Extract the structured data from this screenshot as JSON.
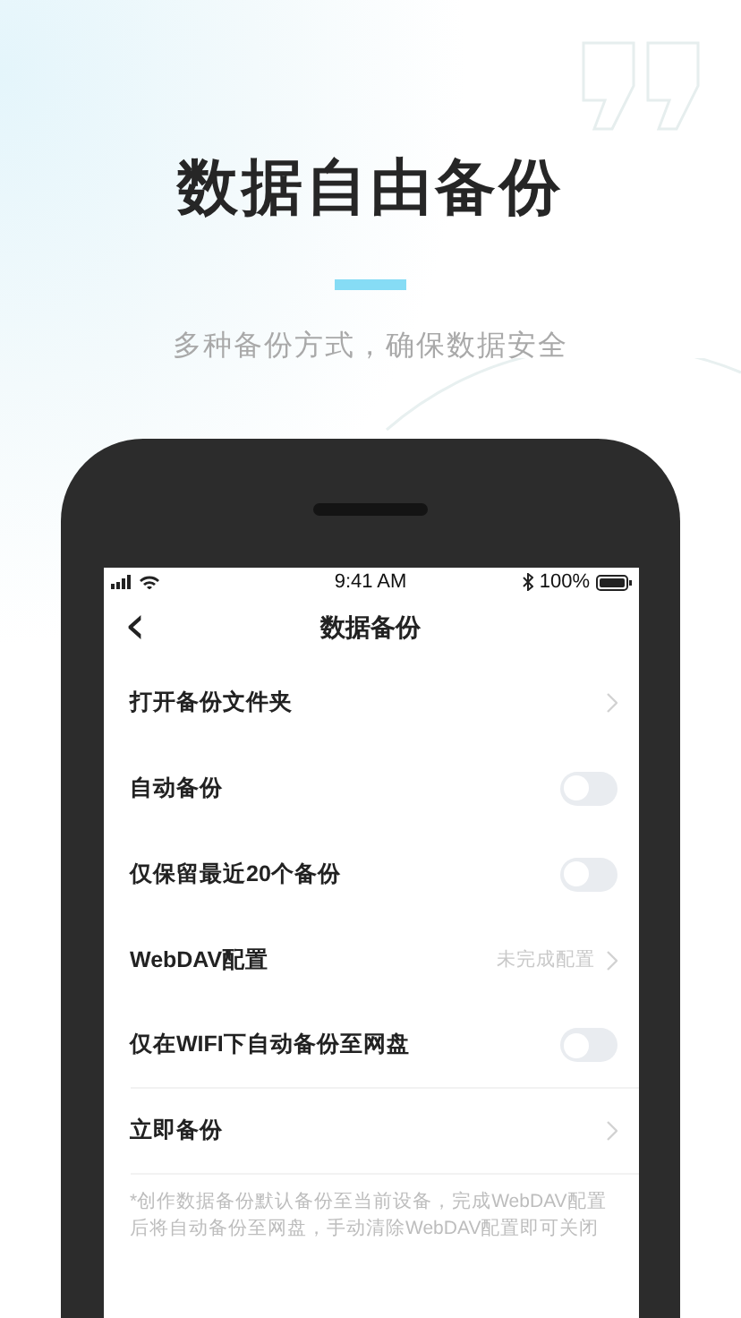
{
  "headline": "数据自由备份",
  "subtitle": "多种备份方式，确保数据安全",
  "status_bar": {
    "time": "9:41 AM",
    "battery": "100%"
  },
  "nav": {
    "back": "‹",
    "title": "数据备份"
  },
  "settings": [
    {
      "kind": "link",
      "label": "打开备份文件夹",
      "divider": false
    },
    {
      "kind": "toggle",
      "label": "自动备份",
      "on": false,
      "divider": false
    },
    {
      "kind": "toggle",
      "label": "仅保留最近20个备份",
      "on": false,
      "divider": false
    },
    {
      "kind": "link",
      "label": "WebDAV配置",
      "value": "未完成配置",
      "divider": false
    },
    {
      "kind": "toggle",
      "label": "仅在WIFI下自动备份至网盘",
      "on": false,
      "divider": true
    },
    {
      "kind": "link",
      "label": "立即备份",
      "divider": true
    }
  ],
  "footnote": "*创作数据备份默认备份至当前设备，完成WebDAV配置后将自动备份至网盘，手动清除WebDAV配置即可关闭"
}
